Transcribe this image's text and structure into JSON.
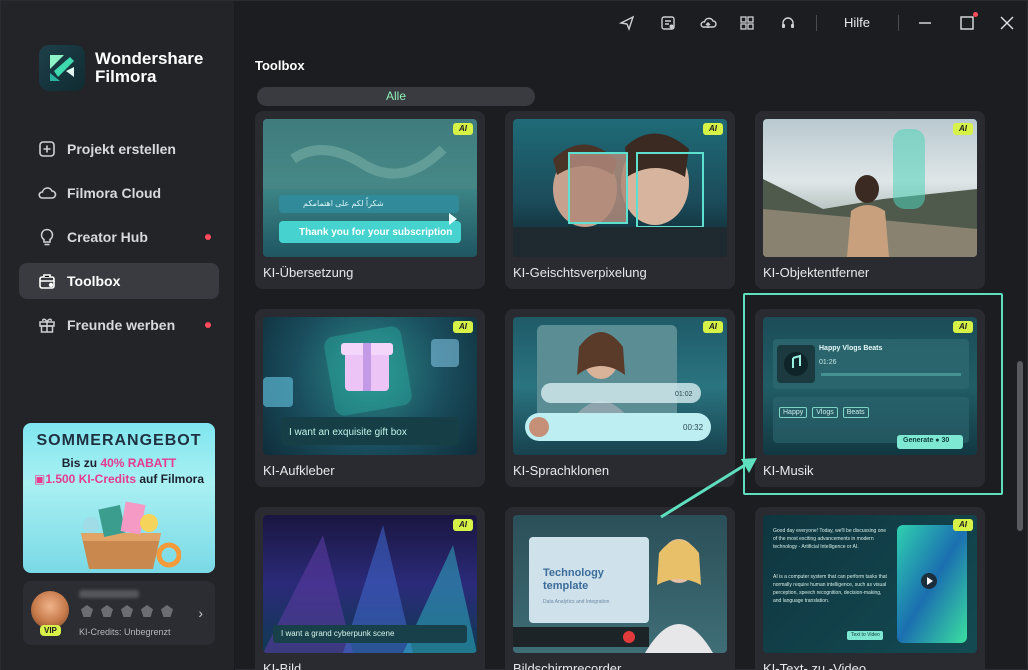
{
  "app": {
    "brand_line1": "Wondershare",
    "brand_line2": "Filmora"
  },
  "titlebar": {
    "icons": [
      "send-icon",
      "media-list-icon",
      "cloud-upload-icon",
      "apps-grid-icon",
      "headset-icon"
    ],
    "help_label": "Hilfe"
  },
  "sidebar": {
    "items": [
      {
        "label": "Projekt erstellen",
        "icon": "add-project-icon",
        "active": false,
        "dot": false
      },
      {
        "label": "Filmora Cloud",
        "icon": "cloud-icon",
        "active": false,
        "dot": false
      },
      {
        "label": "Creator Hub",
        "icon": "lightbulb-icon",
        "active": false,
        "dot": true
      },
      {
        "label": "Toolbox",
        "icon": "toolbox-icon",
        "active": true,
        "dot": false
      },
      {
        "label": "Freunde werben",
        "icon": "gift-icon",
        "active": false,
        "dot": true
      }
    ],
    "promo": {
      "title": "SOMMERANGEBOT",
      "line1_prefix": "Bis zu ",
      "line1_highlight": "40% RABATT",
      "line2_highlight": "1.500 KI-Credits",
      "line2_suffix": " auf Filmora"
    },
    "user": {
      "vip_label": "VIP",
      "credits_text": "KI-Credits: Unbegrenzt"
    }
  },
  "main": {
    "section_title": "Toolbox",
    "filter_label": "Alle",
    "ai_badge": "AI",
    "cards": [
      {
        "label": "KI-Übersetzung",
        "thumb_text1": "شكراً لكم على اهتمامكم",
        "thumb_text2": "Thank you for your subscription"
      },
      {
        "label": "KI-Geischtsverpixelung"
      },
      {
        "label": "KI-Objektentferner"
      },
      {
        "label": "KI-Aufkleber",
        "thumb_text1": "I want an exquisite gift box"
      },
      {
        "label": "KI-Sprachklonen",
        "thumb_text1": "01:02",
        "thumb_text2": "00:32"
      },
      {
        "label": "KI-Musik",
        "thumb_text1": "Happy Vlogs Beats",
        "thumb_text2": "01:26",
        "tags": [
          "Happy",
          "Vlogs",
          "Beats"
        ],
        "generate_label": "Generate",
        "generate_cost": "30"
      },
      {
        "label": "KI-Bild",
        "thumb_text1": "I want a grand cyberpunk scene"
      },
      {
        "label": "Bildschirmrecorder",
        "thumb_text1": "Technology template",
        "thumb_text2": "Data Analytics and Integration"
      },
      {
        "label": "KI-Text- zu -Video",
        "thumb_text1": "Good day everyone! Today, we'll be discussing one of the most exciting advancements in modern technology - Artificial Intelligence or AI.",
        "thumb_text2": "AI is a computer system that can perform tasks that normally require human intelligence, such as visual perception, speech recognition, decision-making, and language translation.",
        "thumb_button": "Text to Video"
      }
    ]
  }
}
